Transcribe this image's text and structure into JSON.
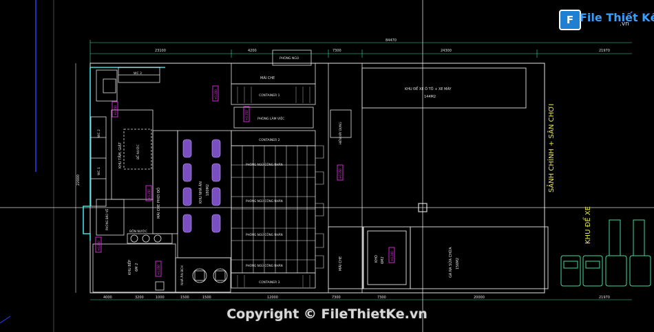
{
  "watermark": {
    "logo_text": "File Thiết Kế",
    "logo_suffix": ".vn",
    "logo_letter": "F",
    "copyright": "Copyright © FileThietKe.vn"
  },
  "colors": {
    "background": "#000000",
    "line_white": "#e6e6e6",
    "line_yellow": "#e8e84a",
    "line_cyan": "#3fe0e0",
    "magenta": "#ff33ff",
    "purple": "#b98cff",
    "green_vehicle": "#3fe0a0",
    "blue_axis": "#2a40ff"
  },
  "plan": {
    "dims_top": [
      "23100",
      "4200",
      "7300",
      "24300",
      "21970"
    ],
    "dim_total_top": "84470",
    "dims_bottom": [
      "4000",
      "3200",
      "1000",
      "1500",
      "1500",
      "12000",
      "7300",
      "7300",
      "20000",
      "21970"
    ],
    "rooms": {
      "phong_ngu_top": "PHÒNG NGỦ",
      "mai_che_top": "MÁI CHE",
      "container_1": "CONTAINER 1",
      "phong_lam_viec": "PHÒNG LÀM VIỆC",
      "container_2": "CONTAINER 2",
      "container_3": "CONTAINER 3",
      "phong_ngu_cn_1": "PHÒNG NGỦ CÔNG NHÂN",
      "phong_ngu_cn_2": "PHÒNG NGỦ CÔNG NHÂN",
      "phong_ngu_cn_3": "PHÒNG NGỦ CÔNG NHÂN",
      "phong_ngu_cn_4": "PHÒNG NGỦ CÔNG NHÂN",
      "khu_nha_an": "KHU NHÀ ĂN",
      "khu_nha_an_area": "180M2",
      "mai_che_phoi_do": "MÁI CHE PHƠI ĐỒ",
      "khu_tam_giat": "KHU TẮM, GIẶT",
      "be_nuoc": "BỂ NƯỚC",
      "bon_nuoc": "BỒN NƯỚC",
      "khu_bep": "KHU BẾP",
      "khu_bep_area": "6M 2",
      "nha_an_bch": "NHÀ ĂN BCH",
      "kho_cho_xe": "KHU ĐỂ XE Ô TÔ + XE MÁY",
      "kho_cho_xe_area": "144M2",
      "sanh_chinh": "SẢNH CHÍNH + SÂN CHƠI",
      "khu_de_xe": "KHU ĐỂ XE",
      "mai_che_right": "MÁI CHE",
      "kho": "KHO",
      "kho_area": "6M2",
      "ga_ra": "GA RA SỬA CHỮA",
      "ga_ra_area": "156M2",
      "wc_labels": [
        "WC 1",
        "WC 2",
        "WC 3"
      ],
      "phong_bao_ve": "PHÒNG BẢO VỆ",
      "hien_xay_dung": "HIÊN XÂY DỰNG"
    },
    "level_tags": [
      "+0.350",
      "+0.350",
      "+0.350",
      "+0.350",
      "+0.350",
      "+0.350",
      "+0.350",
      "+0.300"
    ],
    "axis_left": "22000"
  }
}
